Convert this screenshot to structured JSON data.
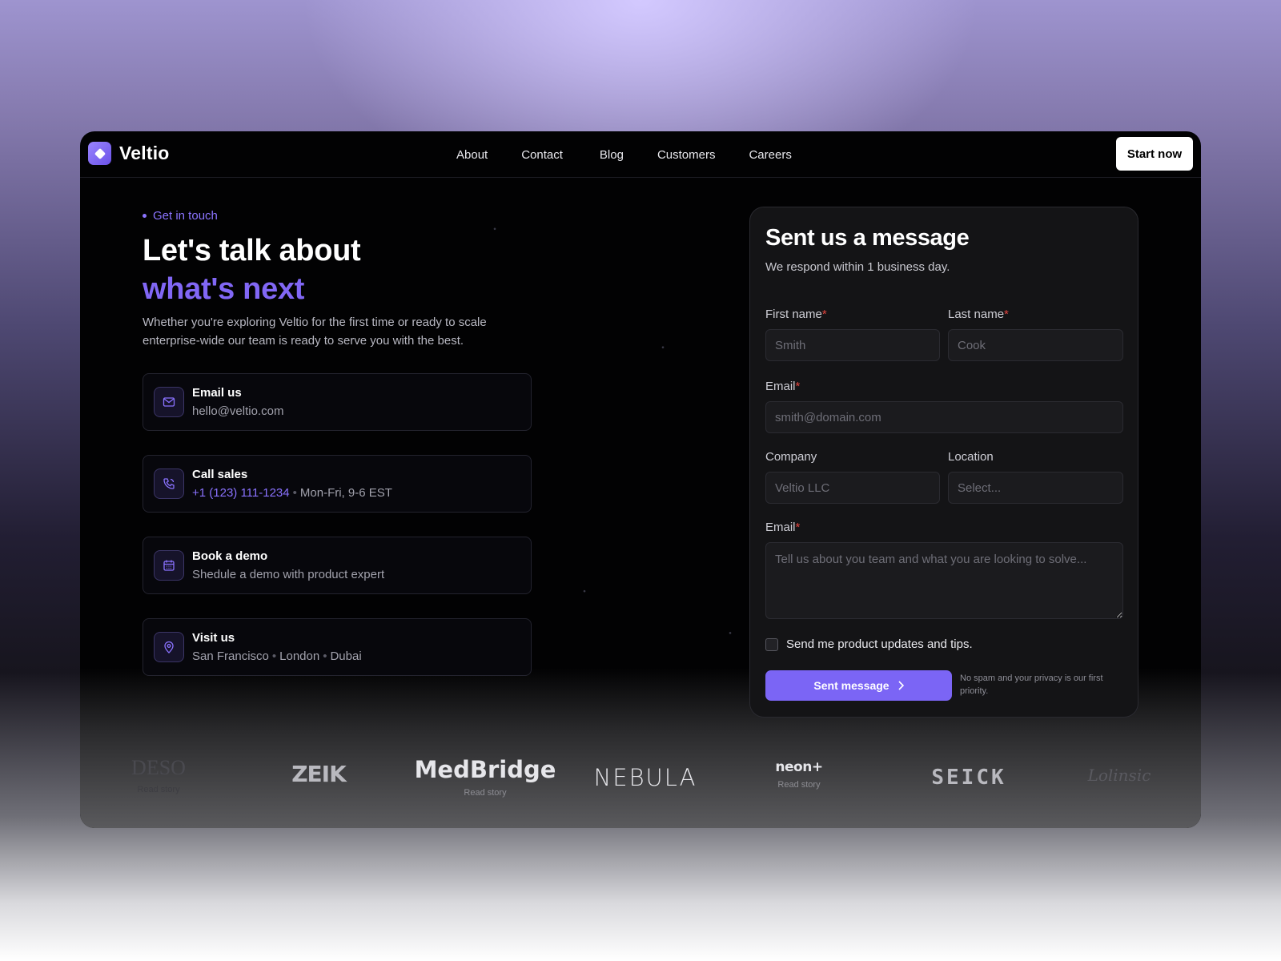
{
  "brand": {
    "name": "Veltio",
    "accent": "#7b65f5"
  },
  "nav": {
    "links": [
      "About",
      "Contact",
      "Blog",
      "Customers",
      "Careers"
    ],
    "cta": "Start now"
  },
  "hero": {
    "eyebrow": "Get in touch",
    "title_line1": "Let's talk about",
    "title_line2": "what's next",
    "lead": "Whether you're exploring Veltio for the first time or ready to scale enterprise-wide our team is ready to serve you with the best."
  },
  "contacts": [
    {
      "icon": "mail-icon",
      "title": "Email us",
      "value": "hello@veltio.com"
    },
    {
      "icon": "phone-icon",
      "title": "Call sales",
      "value": "+1 (123) 111-1234",
      "extra": "Mon-Fri, 9-6 EST"
    },
    {
      "icon": "calendar-icon",
      "title": "Book a demo",
      "value": "Shedule a demo with product expert"
    },
    {
      "icon": "location-pin-icon",
      "title": "Visit us",
      "cities": [
        "San Francisco",
        "London",
        "Dubai"
      ]
    }
  ],
  "form": {
    "title": "Sent us a message",
    "subtitle": "We respond within 1 business day.",
    "first_name": {
      "label": "First name",
      "placeholder": "Smith",
      "required": "*"
    },
    "last_name": {
      "label": "Last name",
      "placeholder": "Cook",
      "required": "*"
    },
    "email": {
      "label": "Email",
      "placeholder": "smith@domain.com",
      "required": "*"
    },
    "company": {
      "label": "Company",
      "placeholder": "Veltio LLC"
    },
    "location": {
      "label": "Location",
      "placeholder": "Select..."
    },
    "message": {
      "label": "Email",
      "placeholder": "Tell us about you team and what you are looking to solve...",
      "required": "*"
    },
    "consent": "Send me product updates and tips.",
    "submit": "Sent message",
    "note": "No spam and your privacy is our first priority."
  },
  "logos": [
    {
      "name": "DESO",
      "cta": "Read story"
    },
    {
      "name": "ZEIK"
    },
    {
      "name": "MedBridge",
      "cta": "Read story"
    },
    {
      "name": "NEBULA"
    },
    {
      "name": "neon+",
      "cta": "Read story"
    },
    {
      "name": "SEICK"
    },
    {
      "name": "Lolinsic"
    }
  ]
}
